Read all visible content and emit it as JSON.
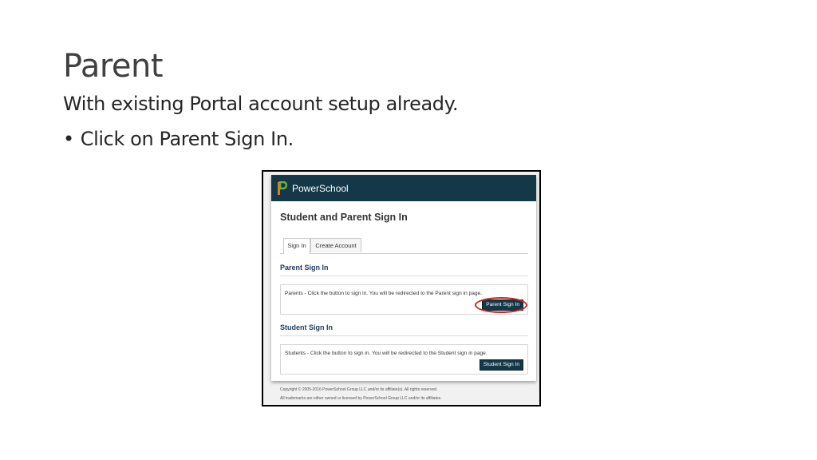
{
  "slide": {
    "title": "Parent",
    "subtitle": "With existing Portal account setup already.",
    "bullet_marker": "•",
    "bullet": "Click on Parent Sign In."
  },
  "screenshot": {
    "brand": "PowerSchool",
    "heading": "Student and Parent Sign In",
    "tabs": [
      {
        "label": "Sign In",
        "active": true
      },
      {
        "label": "Create Account",
        "active": false
      }
    ],
    "parent_section": {
      "title": "Parent Sign In",
      "text": "Parents - Click the button to sign in. You will be redirected to the Parent sign in page.",
      "button": "Parent Sign In"
    },
    "student_section": {
      "title": "Student Sign In",
      "text": "Students - Click the button to sign in. You will be redirected to the Student sign in page.",
      "button": "Student Sign In"
    },
    "footer": [
      "Copyright © 2005-2016 PowerSchool Group LLC and/or its affiliate(s). All rights reserved.",
      "All trademarks are either owned or licensed by PowerSchool Group LLC and/or its affiliates."
    ],
    "colors": {
      "header_bg": "#143848",
      "button_bg": "#143848",
      "highlight": "#c62828",
      "logo_orange": "#e87722",
      "logo_green": "#6cb33f"
    }
  }
}
